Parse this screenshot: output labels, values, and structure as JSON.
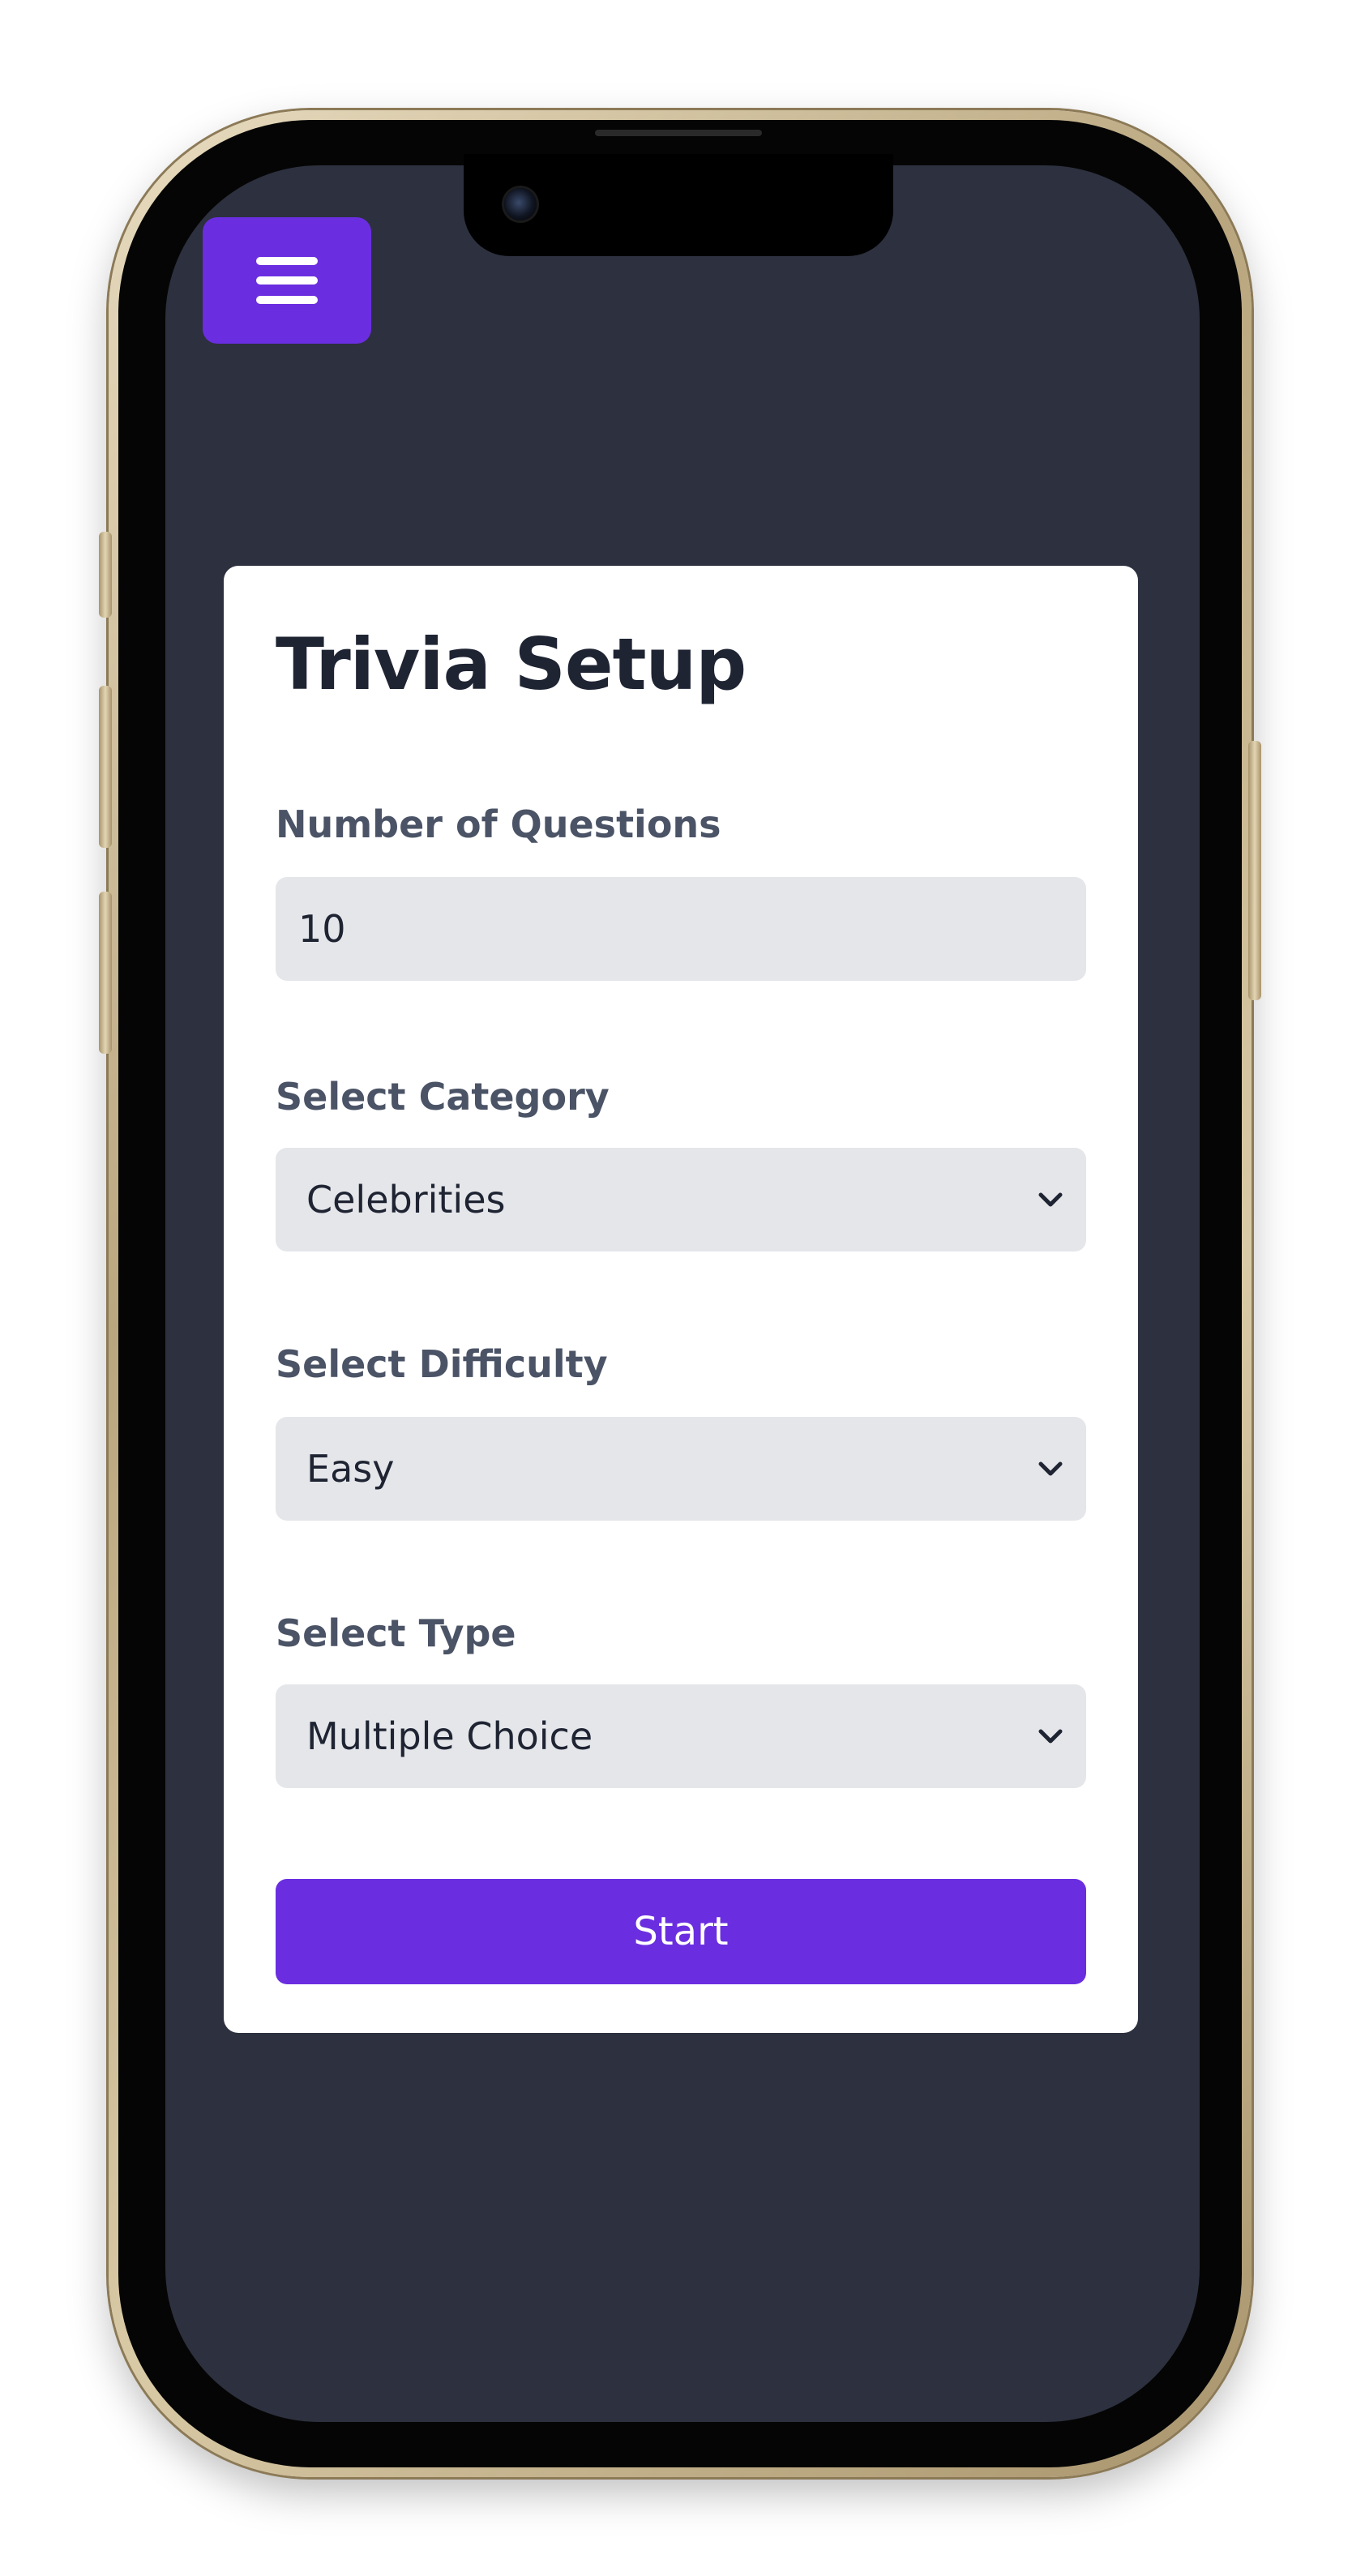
{
  "app": {
    "menu_icon": "hamburger-menu-icon"
  },
  "setup": {
    "title": "Trivia Setup",
    "questions": {
      "label": "Number of Questions",
      "value": "10"
    },
    "category": {
      "label": "Select Category",
      "selected": "Celebrities"
    },
    "difficulty": {
      "label": "Select Difficulty",
      "selected": "Easy"
    },
    "type": {
      "label": "Select Type",
      "selected": "Multiple Choice"
    },
    "start_label": "Start"
  },
  "colors": {
    "accent": "#6a2ee0",
    "background": "#2d303e",
    "card": "#ffffff",
    "field": "#e5e6ea",
    "title_text": "#1f2433",
    "label_text": "#4b5366"
  }
}
